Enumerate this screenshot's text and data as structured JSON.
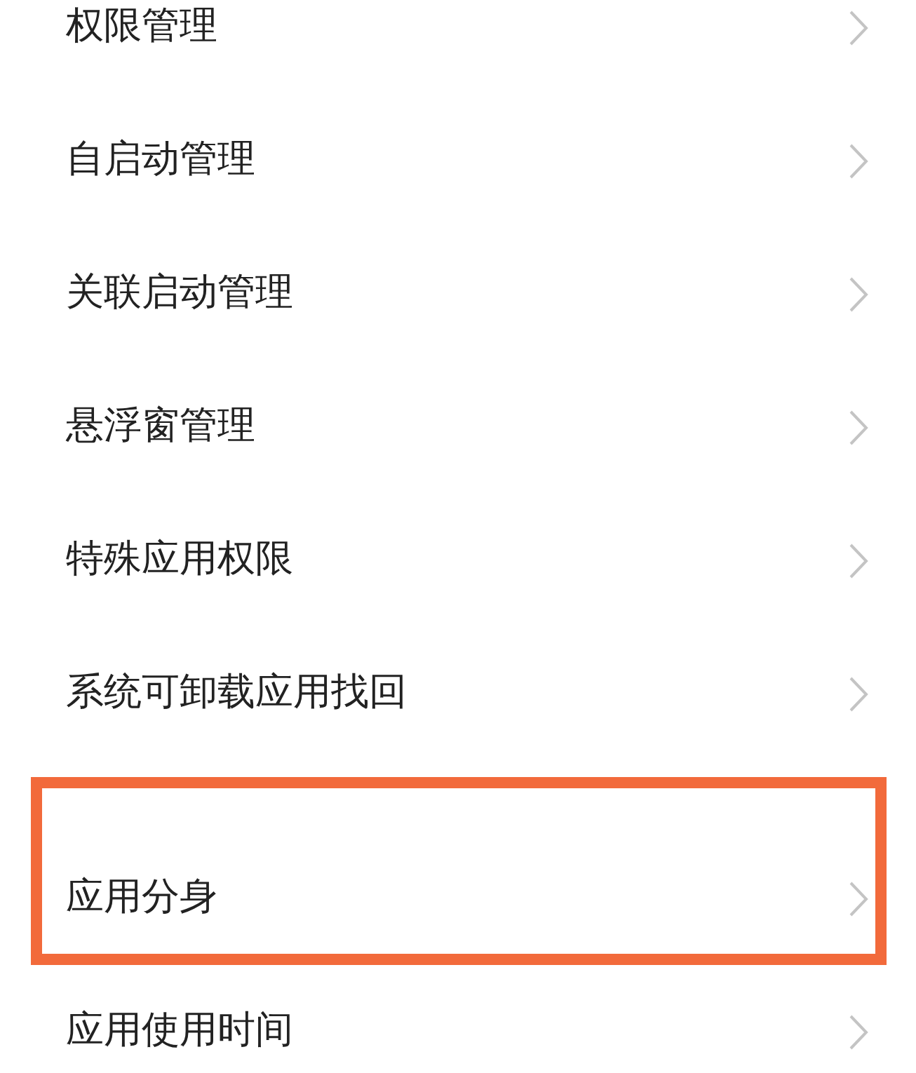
{
  "menu_items": [
    {
      "label": "权限管理",
      "group_start": false,
      "highlighted": false
    },
    {
      "label": "自启动管理",
      "group_start": false,
      "highlighted": false
    },
    {
      "label": "关联启动管理",
      "group_start": false,
      "highlighted": false
    },
    {
      "label": "悬浮窗管理",
      "group_start": false,
      "highlighted": false
    },
    {
      "label": "特殊应用权限",
      "group_start": false,
      "highlighted": false
    },
    {
      "label": "系统可卸载应用找回",
      "group_start": false,
      "highlighted": false
    },
    {
      "label": "应用分身",
      "group_start": true,
      "highlighted": true
    },
    {
      "label": "应用使用时间",
      "group_start": false,
      "highlighted": false
    }
  ]
}
